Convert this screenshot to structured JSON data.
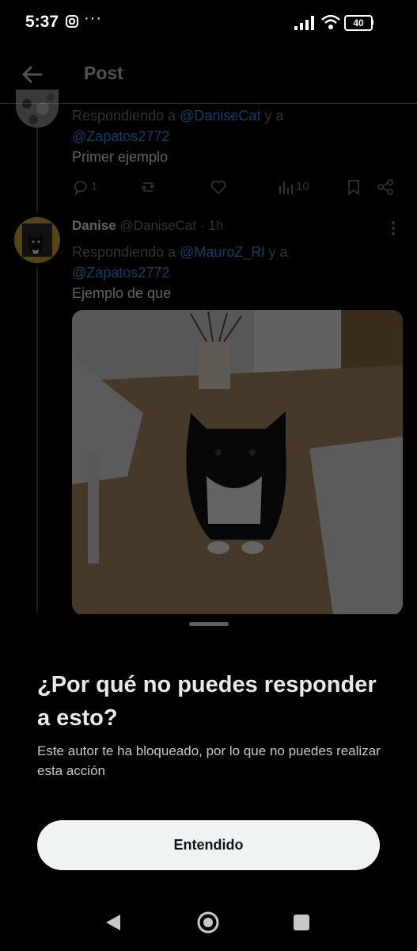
{
  "status_bar": {
    "time": "5:37",
    "dots": "···",
    "battery": "40"
  },
  "header": {
    "title": "Post",
    "back_icon": "arrow-left-icon"
  },
  "tweet1": {
    "reply_prefix": "Respondiendo a",
    "mention1": "@DaniseCat",
    "connector": "y a",
    "mention2": "@Zapatos2772",
    "text": "Primer ejemplo",
    "reply_count": "1",
    "views_count": "10"
  },
  "tweet2": {
    "name": "Danise",
    "handle": "@DaniseCat",
    "time": "· 1h",
    "reply_prefix": "Respondiendo a",
    "mention1": "@MauroZ_Rl",
    "connector": "y a",
    "mention2": "@Zapatos2772",
    "text": "Ejemplo de que"
  },
  "sheet": {
    "title": "¿Por qué no puedes responder a esto?",
    "body": "Este autor te ha bloqueado, por lo que no puedes realizar esta acción",
    "button_label": "Entendido"
  },
  "colors": {
    "accent": "#1d9bf0",
    "background": "#000000",
    "button": "#eff3f4"
  }
}
